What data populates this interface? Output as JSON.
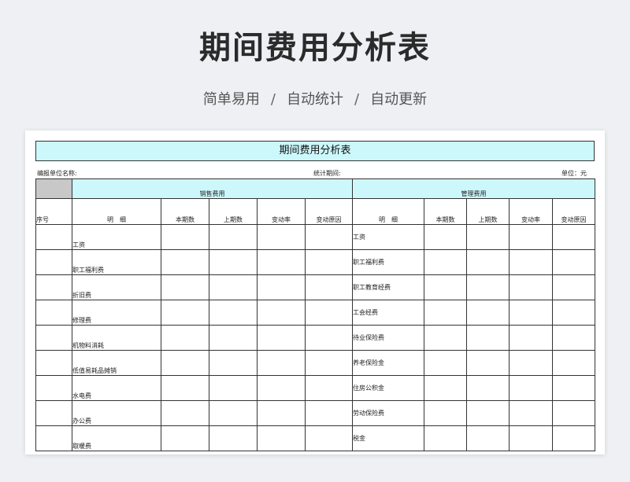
{
  "hero": {
    "title": "期间费用分析表",
    "tags": [
      "简单易用",
      "自动统计",
      "自动更新"
    ],
    "separator": "/"
  },
  "sheet": {
    "title": "期间费用分析表",
    "unit_name_label": "编报单位名称:",
    "period_label": "统计期间:",
    "unit_label": "单位：元"
  },
  "table": {
    "seq_header": "序号",
    "sales_group": "销售费用",
    "admin_group": "管理费用",
    "columns": [
      "明　细",
      "本期数",
      "上期数",
      "变动率",
      "变动原因"
    ],
    "sales_items": [
      "工资",
      "职工福利费",
      "折旧费",
      "修理费",
      "机物料消耗",
      "低值易耗品摊销",
      "水电费",
      "办公费",
      "取暖费"
    ],
    "admin_items": [
      "工资",
      "职工福利费",
      "职工教育经费",
      "工会经费",
      "待业保险费",
      "养老保险金",
      " 住房公积金",
      "劳动保险费",
      "税金"
    ]
  }
}
